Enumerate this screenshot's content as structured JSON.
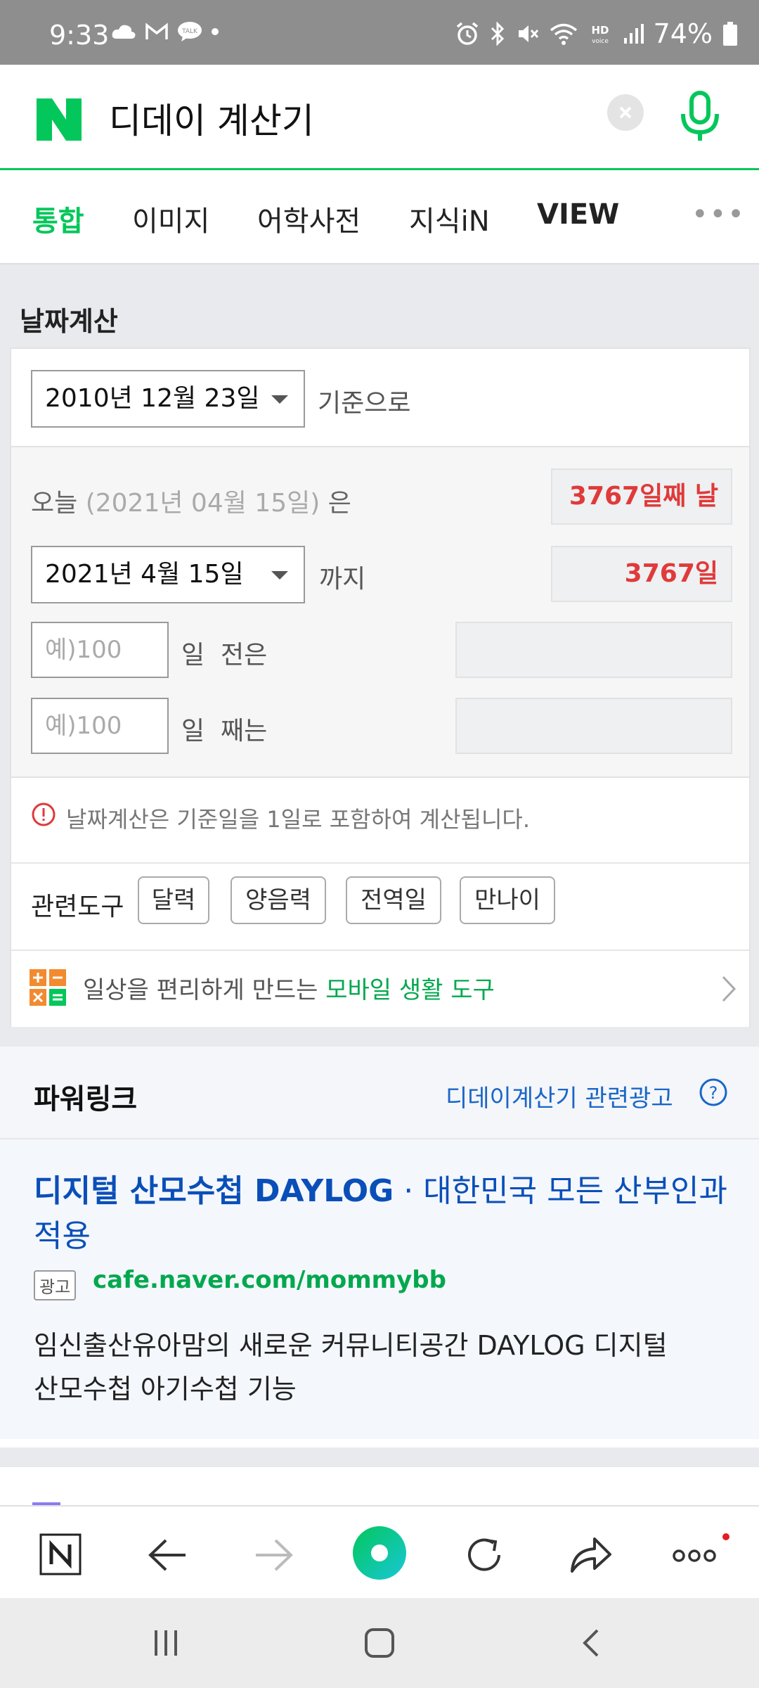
{
  "status_bar": {
    "time": "9:33",
    "battery": "74%"
  },
  "search": {
    "query": "디데이 계산기"
  },
  "tabs": [
    {
      "label": "통합",
      "active": true
    },
    {
      "label": "이미지"
    },
    {
      "label": "어학사전"
    },
    {
      "label": "지식iN"
    },
    {
      "label": "VIEW"
    }
  ],
  "date_calc": {
    "title": "날짜계산",
    "base_date": "2010년 12월 23일",
    "base_suffix": "기준으로",
    "today_prefix": "오늘",
    "today_date": "(2021년 04월 15일)",
    "today_suffix": "은",
    "today_result": "3767일째 날",
    "until_date": "2021년 4월 15일",
    "until_suffix": "까지",
    "until_result": "3767일",
    "before_placeholder": "예)100",
    "before_label": "일  전은",
    "after_placeholder": "예)100",
    "after_label": "일  째는",
    "notice": "날짜계산은 기준일을 1일로 포함하여 계산됩니다.",
    "related_label": "관련도구",
    "related_tools": [
      "달력",
      "양음력",
      "전역일",
      "만나이"
    ],
    "promo_text": "일상을 편리하게 만드는",
    "promo_link": "모바일 생활 도구"
  },
  "powerlink": {
    "title": "파워링크",
    "related_ad_label": "디데이계산기 관련광고",
    "ad": {
      "title": "디지털 산모수첩 DAYLOG",
      "subtitle_line1": "· 대한민국 모든 산부인과",
      "subtitle_line2": "적용",
      "badge": "광고",
      "url": "cafe.naver.com/mommybb",
      "desc_line1": "임신출산유아맘의 새로운 커뮤니티공간 DAYLOG 디지털",
      "desc_line2": "산모수첩 아기수첩 기능"
    }
  },
  "colors": {
    "naver_green": "#03c75a",
    "result_red": "#e03a3a",
    "link_blue": "#0a4fb8"
  }
}
